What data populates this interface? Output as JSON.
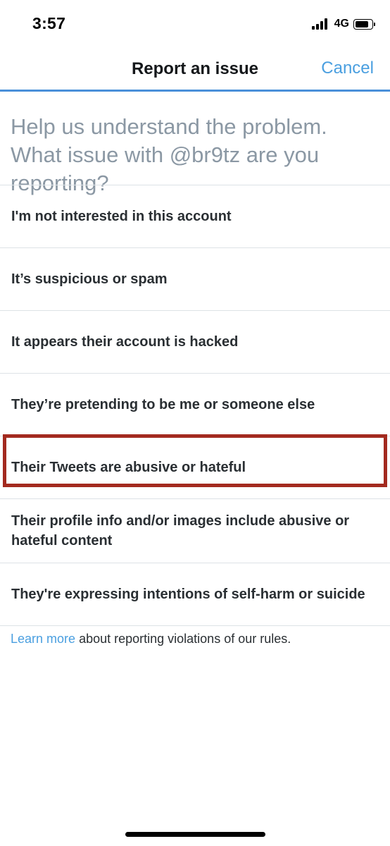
{
  "status_bar": {
    "time": "3:57",
    "network": "4G"
  },
  "nav": {
    "title": "Report an issue",
    "cancel_label": "Cancel"
  },
  "prompt": "Help us understand the problem. What issue with @br9tz are you reporting?",
  "options": [
    {
      "label": "I'm not interested in this account"
    },
    {
      "label": "It’s suspicious or spam"
    },
    {
      "label": "It appears their account is hacked"
    },
    {
      "label": "They’re pretending to be me or someone else"
    },
    {
      "label": "Their Tweets are abusive or hateful",
      "highlighted": true
    },
    {
      "label": "Their profile info and/or images include abusive or hateful content"
    },
    {
      "label": "They're expressing intentions of self-harm or suicide"
    }
  ],
  "footer": {
    "link_label": "Learn more",
    "text": " about reporting violations of our rules."
  },
  "colors": {
    "accent": "#4a9fe0",
    "highlight_border": "#a32a1f",
    "prompt_text": "#8b98a4"
  }
}
